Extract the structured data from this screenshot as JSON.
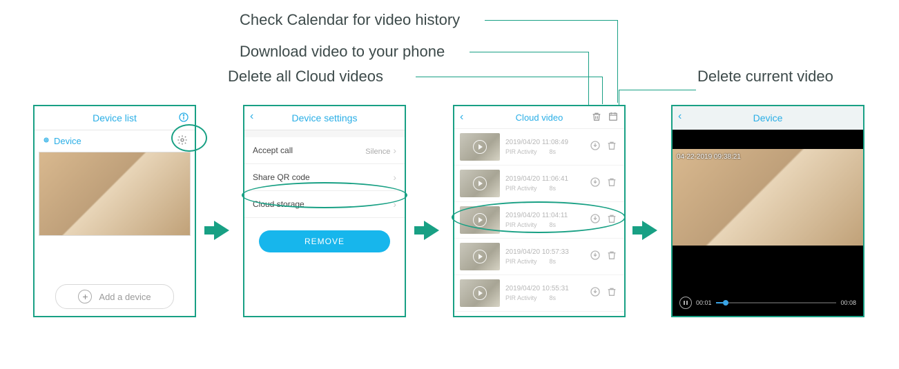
{
  "annotations": {
    "calendar": "Check Calendar for video history",
    "download": "Download video to your phone",
    "deleteAll": "Delete all Cloud videos",
    "deleteCurrent": "Delete current video"
  },
  "screen1": {
    "title": "Device list",
    "deviceLabel": "Device",
    "addDevice": "Add a device"
  },
  "screen2": {
    "title": "Device settings",
    "rows": {
      "acceptCall": {
        "label": "Accept call",
        "value": "Silence"
      },
      "shareQR": {
        "label": "Share QR code"
      },
      "cloud": {
        "label": "Cloud storage"
      }
    },
    "remove": "REMOVE"
  },
  "screen3": {
    "title": "Cloud video",
    "items": [
      {
        "ts": "2019/04/20 11:08:49",
        "sub": "PIR Activity",
        "dur": "8s"
      },
      {
        "ts": "2019/04/20 11:06:41",
        "sub": "PIR Activity",
        "dur": "8s"
      },
      {
        "ts": "2019/04/20 11:04:11",
        "sub": "PIR Activity",
        "dur": "8s"
      },
      {
        "ts": "2019/04/20 10:57:33",
        "sub": "PIR Activity",
        "dur": "8s"
      },
      {
        "ts": "2019/04/20 10:55:31",
        "sub": "PIR Activity",
        "dur": "8s"
      }
    ]
  },
  "screen4": {
    "title": "Device",
    "timestamp": "04-22-2019 09:38:21",
    "cur": "00:01",
    "total": "00:08"
  }
}
